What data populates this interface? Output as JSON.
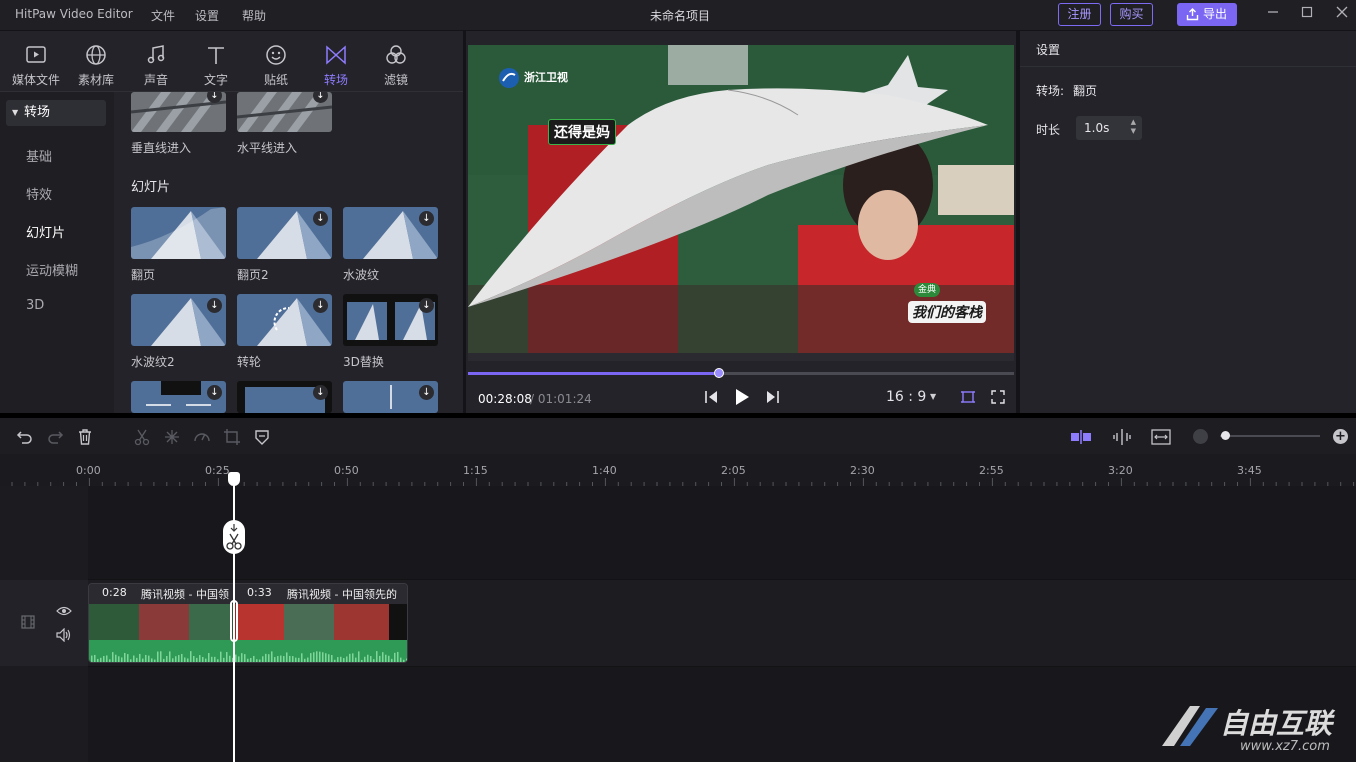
{
  "app": {
    "title": "HitPaw Video Editor",
    "menus": [
      "文件",
      "设置",
      "帮助"
    ],
    "project_name": "未命名项目",
    "register_label": "注册",
    "buy_label": "购买",
    "export_label": "导出",
    "accent": "#7a66f3"
  },
  "tabs": [
    {
      "label": "媒体文件",
      "icon": "media-icon"
    },
    {
      "label": "素材库",
      "icon": "globe-icon"
    },
    {
      "label": "声音",
      "icon": "music-icon"
    },
    {
      "label": "文字",
      "icon": "text-icon"
    },
    {
      "label": "贴纸",
      "icon": "sticker-icon"
    },
    {
      "label": "转场",
      "icon": "transition-icon",
      "active": true
    },
    {
      "label": "滤镜",
      "icon": "filter-icon"
    }
  ],
  "categories": {
    "header": "转场",
    "items": [
      "基础",
      "特效",
      "幻灯片",
      "运动模糊",
      "3D"
    ],
    "selected": "幻灯片"
  },
  "transitions": {
    "top_row": [
      "垂直线进入",
      "水平线进入"
    ],
    "section_title": "幻灯片",
    "grid": [
      "翻页",
      "翻页2",
      "水波纹",
      "水波纹2",
      "转轮",
      "3D替换"
    ]
  },
  "preview": {
    "current_time": "00:28:08",
    "total_time": "/ 01:01:24",
    "aspect_ratio": "16 : 9",
    "progress": 0.46,
    "channel_logo": "浙江卫视",
    "caption_left": "还得是妈",
    "caption_right": "我们的客栈",
    "caption_right_badge": "金典"
  },
  "settings": {
    "title": "设置",
    "transition_label": "转场:",
    "transition_value": "翻页",
    "duration_label": "时长",
    "duration_value": "1.0s"
  },
  "timeline": {
    "ruler": [
      "0:00",
      "0:25",
      "0:50",
      "1:15",
      "1:40",
      "2:05",
      "2:30",
      "2:55",
      "3:20",
      "3:45"
    ],
    "clips": [
      {
        "duration": "0:28",
        "name": "腾讯视频 - 中国领"
      },
      {
        "duration": "0:33",
        "name": "腾讯视频 - 中国领先的"
      }
    ]
  },
  "watermark": {
    "text": "自由互联",
    "sub": "www.xz7.com"
  }
}
